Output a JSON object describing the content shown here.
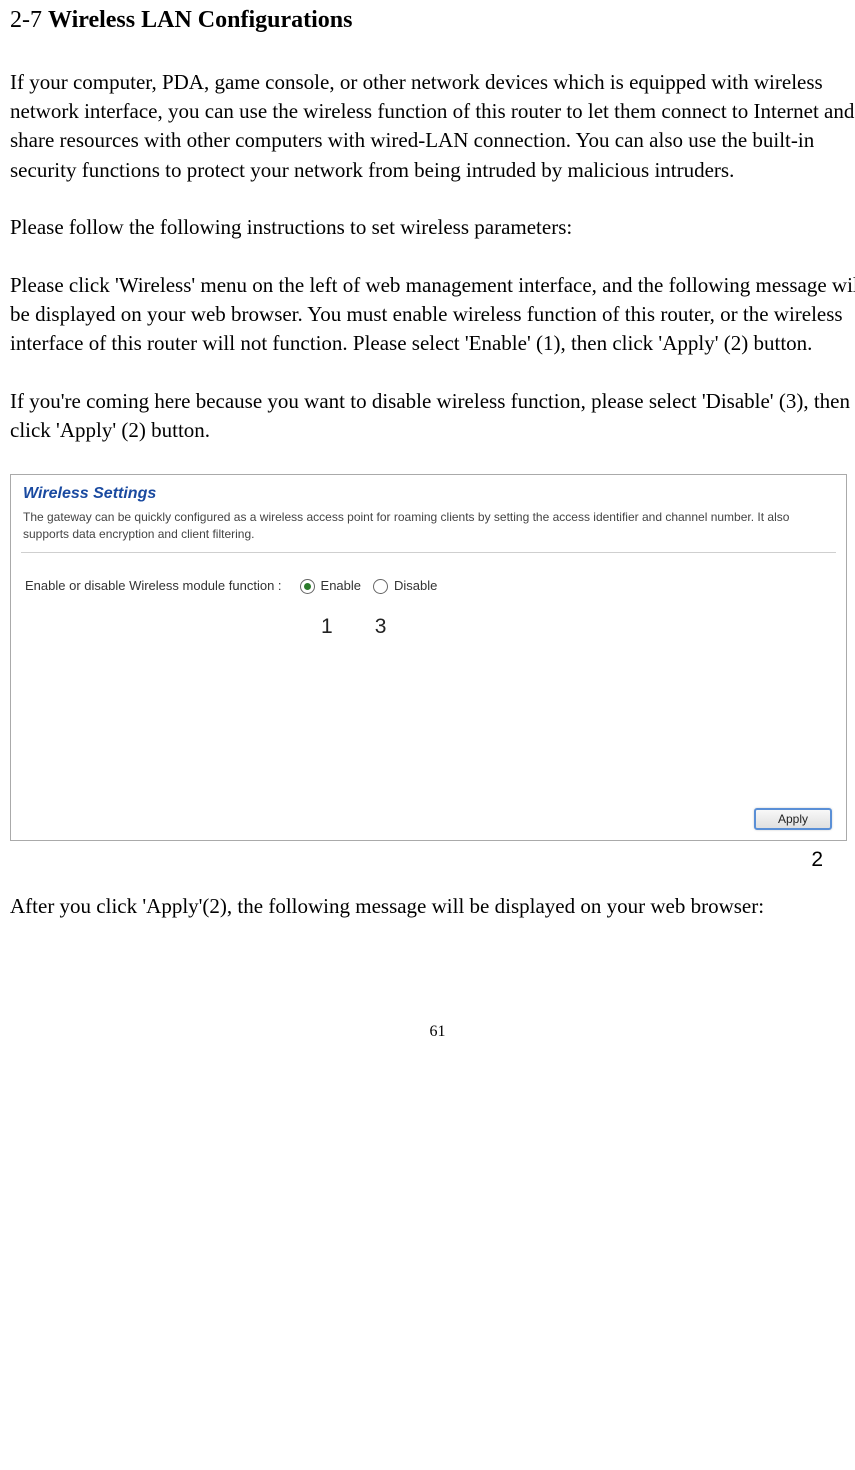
{
  "heading": {
    "prefix": "2-7 ",
    "title": "Wireless LAN Configurations"
  },
  "paragraphs": {
    "p1": "If your computer, PDA, game console, or other network devices which is equipped with wireless network interface, you can use the wireless function of this router to let them connect to Internet and share resources with other computers with wired-LAN connection. You can also use the built-in security functions to protect your network from being intruded by malicious intruders.",
    "p2": "Please follow the following instructions to set wireless parameters:",
    "p3": "Please click 'Wireless' menu on the left of web management interface, and the following message will be displayed on your web browser. You must enable wireless function of this router, or the wireless interface of this router will not function. Please select 'Enable' (1), then click 'Apply' (2) button.",
    "p4": "If you're coming here because you want to disable wireless function, please select 'Disable' (3), then click 'Apply' (2) button.",
    "p5": "After you click 'Apply'(2), the following message will be displayed on your web browser:"
  },
  "screenshot": {
    "title": "Wireless Settings",
    "description": "The gateway can be quickly configured as a wireless access point for roaming clients by setting the access identifier and channel number. It also supports data encryption and client filtering.",
    "form_label": "Enable or disable Wireless module function :",
    "enable_label": "Enable",
    "disable_label": "Disable",
    "apply_label": "Apply"
  },
  "annotations": {
    "a1": "1",
    "a3": "3",
    "a2": "2"
  },
  "page_number": "61"
}
